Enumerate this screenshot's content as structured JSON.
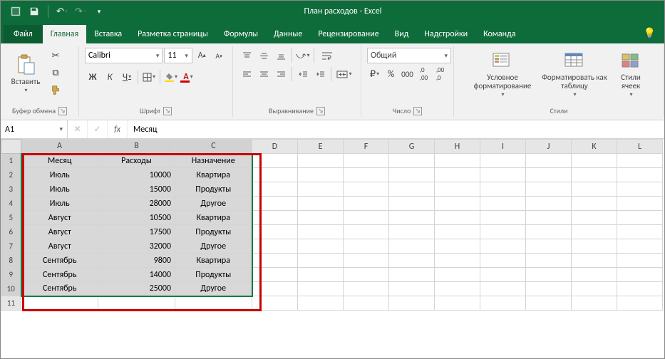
{
  "app": {
    "title": "План расходов - Excel"
  },
  "tabs": {
    "file": "Файл",
    "items": [
      "Главная",
      "Вставка",
      "Разметка страницы",
      "Формулы",
      "Данные",
      "Рецензирование",
      "Вид",
      "Надстройки",
      "Команда"
    ],
    "active_index": 0
  },
  "ribbon": {
    "clipboard": {
      "label": "Буфер обмена",
      "paste": "Вставить"
    },
    "font": {
      "label": "Шрифт",
      "name": "Calibri",
      "size": "11",
      "bold": "Ж",
      "italic": "К",
      "underline": "Ч"
    },
    "alignment": {
      "label": "Выравнивание"
    },
    "number": {
      "label": "Число",
      "format": "Общий"
    },
    "styles": {
      "label": "Стили",
      "cond": "Условное форматирование",
      "table": "Форматировать как таблицу",
      "cell": "Стили ячеек"
    }
  },
  "formula": {
    "cell_ref": "A1",
    "value": "Месяц"
  },
  "columns": [
    "A",
    "B",
    "C",
    "D",
    "E",
    "F",
    "G",
    "H",
    "I",
    "J",
    "K",
    "L"
  ],
  "selection": {
    "rows": 10,
    "cols": 3
  },
  "table": {
    "headers": [
      "Месяц",
      "Расходы",
      "Назначение"
    ],
    "rows": [
      [
        "Июль",
        "10000",
        "Квартира"
      ],
      [
        "Июль",
        "15000",
        "Продукты"
      ],
      [
        "Июль",
        "28000",
        "Другое"
      ],
      [
        "Август",
        "10500",
        "Квартира"
      ],
      [
        "Август",
        "17500",
        "Продукты"
      ],
      [
        "Август",
        "32000",
        "Другое"
      ],
      [
        "Сентябрь",
        "9800",
        "Квартира"
      ],
      [
        "Сентябрь",
        "14000",
        "Продукты"
      ],
      [
        "Сентябрь",
        "25000",
        "Другое"
      ]
    ]
  },
  "total_visible_rows": 11
}
